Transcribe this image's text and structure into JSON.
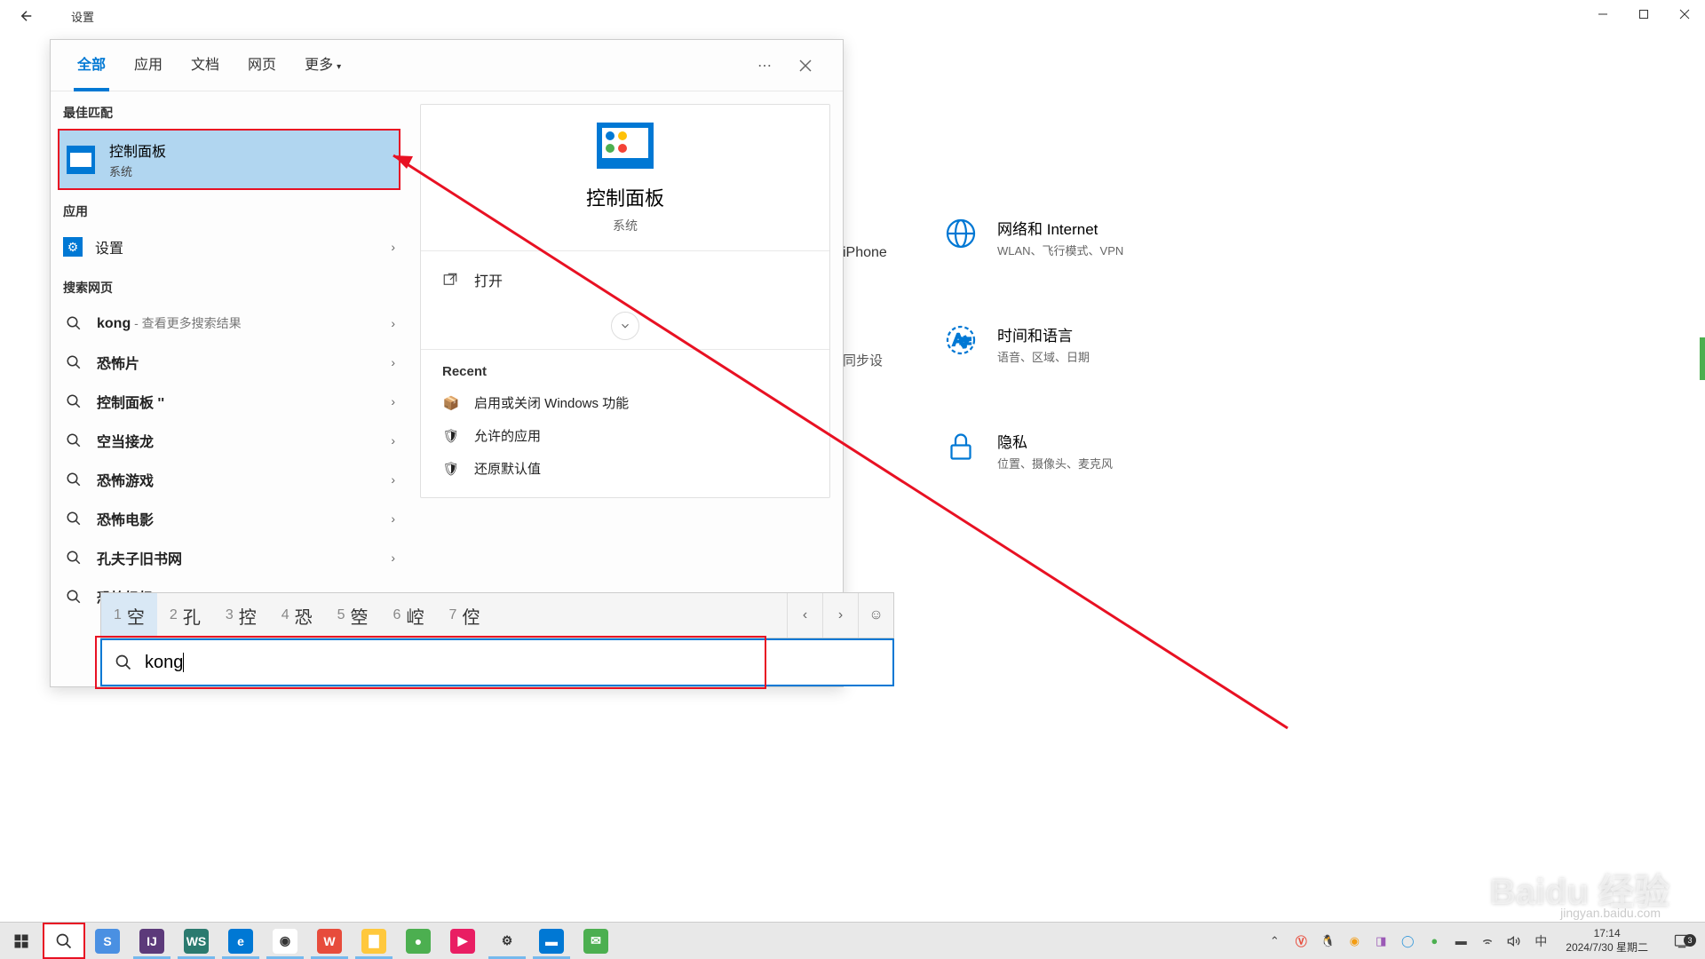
{
  "settings_window": {
    "title": "设置",
    "categories": [
      {
        "icon_name": "iphone",
        "title": "",
        "sub": "iPhone"
      },
      {
        "icon_name": "globe",
        "title": "网络和 Internet",
        "sub": "WLAN、飞行模式、VPN"
      },
      {
        "icon_name": "sync",
        "title": "",
        "sub": "同步设"
      },
      {
        "icon_name": "lang",
        "title": "时间和语言",
        "sub": "语音、区域、日期"
      },
      {
        "icon_name": "lock",
        "title": "隐私",
        "sub": "位置、摄像头、麦克风"
      }
    ]
  },
  "search": {
    "tabs": [
      "全部",
      "应用",
      "文档",
      "网页",
      "更多"
    ],
    "active_tab": 0,
    "best_match_header": "最佳匹配",
    "best_match": {
      "title": "控制面板",
      "sub": "系统"
    },
    "apps_header": "应用",
    "apps": [
      {
        "label": "设置",
        "icon": "gear"
      }
    ],
    "web_header": "搜索网页",
    "web_results": [
      {
        "label": "kong",
        "sub": " - 查看更多搜索结果"
      },
      {
        "label": "恐怖片",
        "sub": ""
      },
      {
        "label": "控制面板 ''",
        "sub": ""
      },
      {
        "label": "空当接龙",
        "sub": ""
      },
      {
        "label": "恐怖游戏",
        "sub": ""
      },
      {
        "label": "恐怖电影",
        "sub": ""
      },
      {
        "label": "孔夫子旧书网",
        "sub": ""
      },
      {
        "label": "恐怖奶奶",
        "sub": ""
      }
    ],
    "preview": {
      "title": "控制面板",
      "sub": "系统",
      "open_label": "打开",
      "recent_header": "Recent",
      "recent": [
        "启用或关闭 Windows 功能",
        "允许的应用",
        "还原默认值"
      ]
    },
    "ime": {
      "candidates": [
        "空",
        "孔",
        "控",
        "恐",
        "箜",
        "崆",
        "倥"
      ],
      "selected": 0
    },
    "input_value": "kong"
  },
  "taskbar": {
    "apps": [
      {
        "name": "sogou",
        "color": "#4a90e2",
        "glyph": "S",
        "running": false
      },
      {
        "name": "intellij",
        "color": "#5c3a7a",
        "glyph": "IJ",
        "running": true
      },
      {
        "name": "webstorm",
        "color": "#2b7a6f",
        "glyph": "WS",
        "running": true
      },
      {
        "name": "edge",
        "color": "#0078d4",
        "glyph": "e",
        "running": true
      },
      {
        "name": "chrome",
        "color": "#fff",
        "glyph": "◉",
        "running": true
      },
      {
        "name": "wps",
        "color": "#e74c3c",
        "glyph": "W",
        "running": true
      },
      {
        "name": "explorer",
        "color": "#ffc83d",
        "glyph": "▇",
        "running": true
      },
      {
        "name": "app-green",
        "color": "#4caf50",
        "glyph": "●",
        "running": false
      },
      {
        "name": "app-pink",
        "color": "#e91e63",
        "glyph": "▶",
        "running": false
      },
      {
        "name": "settings",
        "color": "transparent",
        "glyph": "⚙",
        "running": true
      },
      {
        "name": "control-panel",
        "color": "#0078d4",
        "glyph": "▬",
        "running": true
      },
      {
        "name": "wechat",
        "color": "#4caf50",
        "glyph": "✉",
        "running": false
      }
    ],
    "tray_ime": "中",
    "clock_time": "17:14",
    "clock_date": "2024/7/30 星期二",
    "notif_count": "3"
  },
  "watermark": {
    "main": "Baidu 经验",
    "sub": "jingyan.baidu.com"
  }
}
